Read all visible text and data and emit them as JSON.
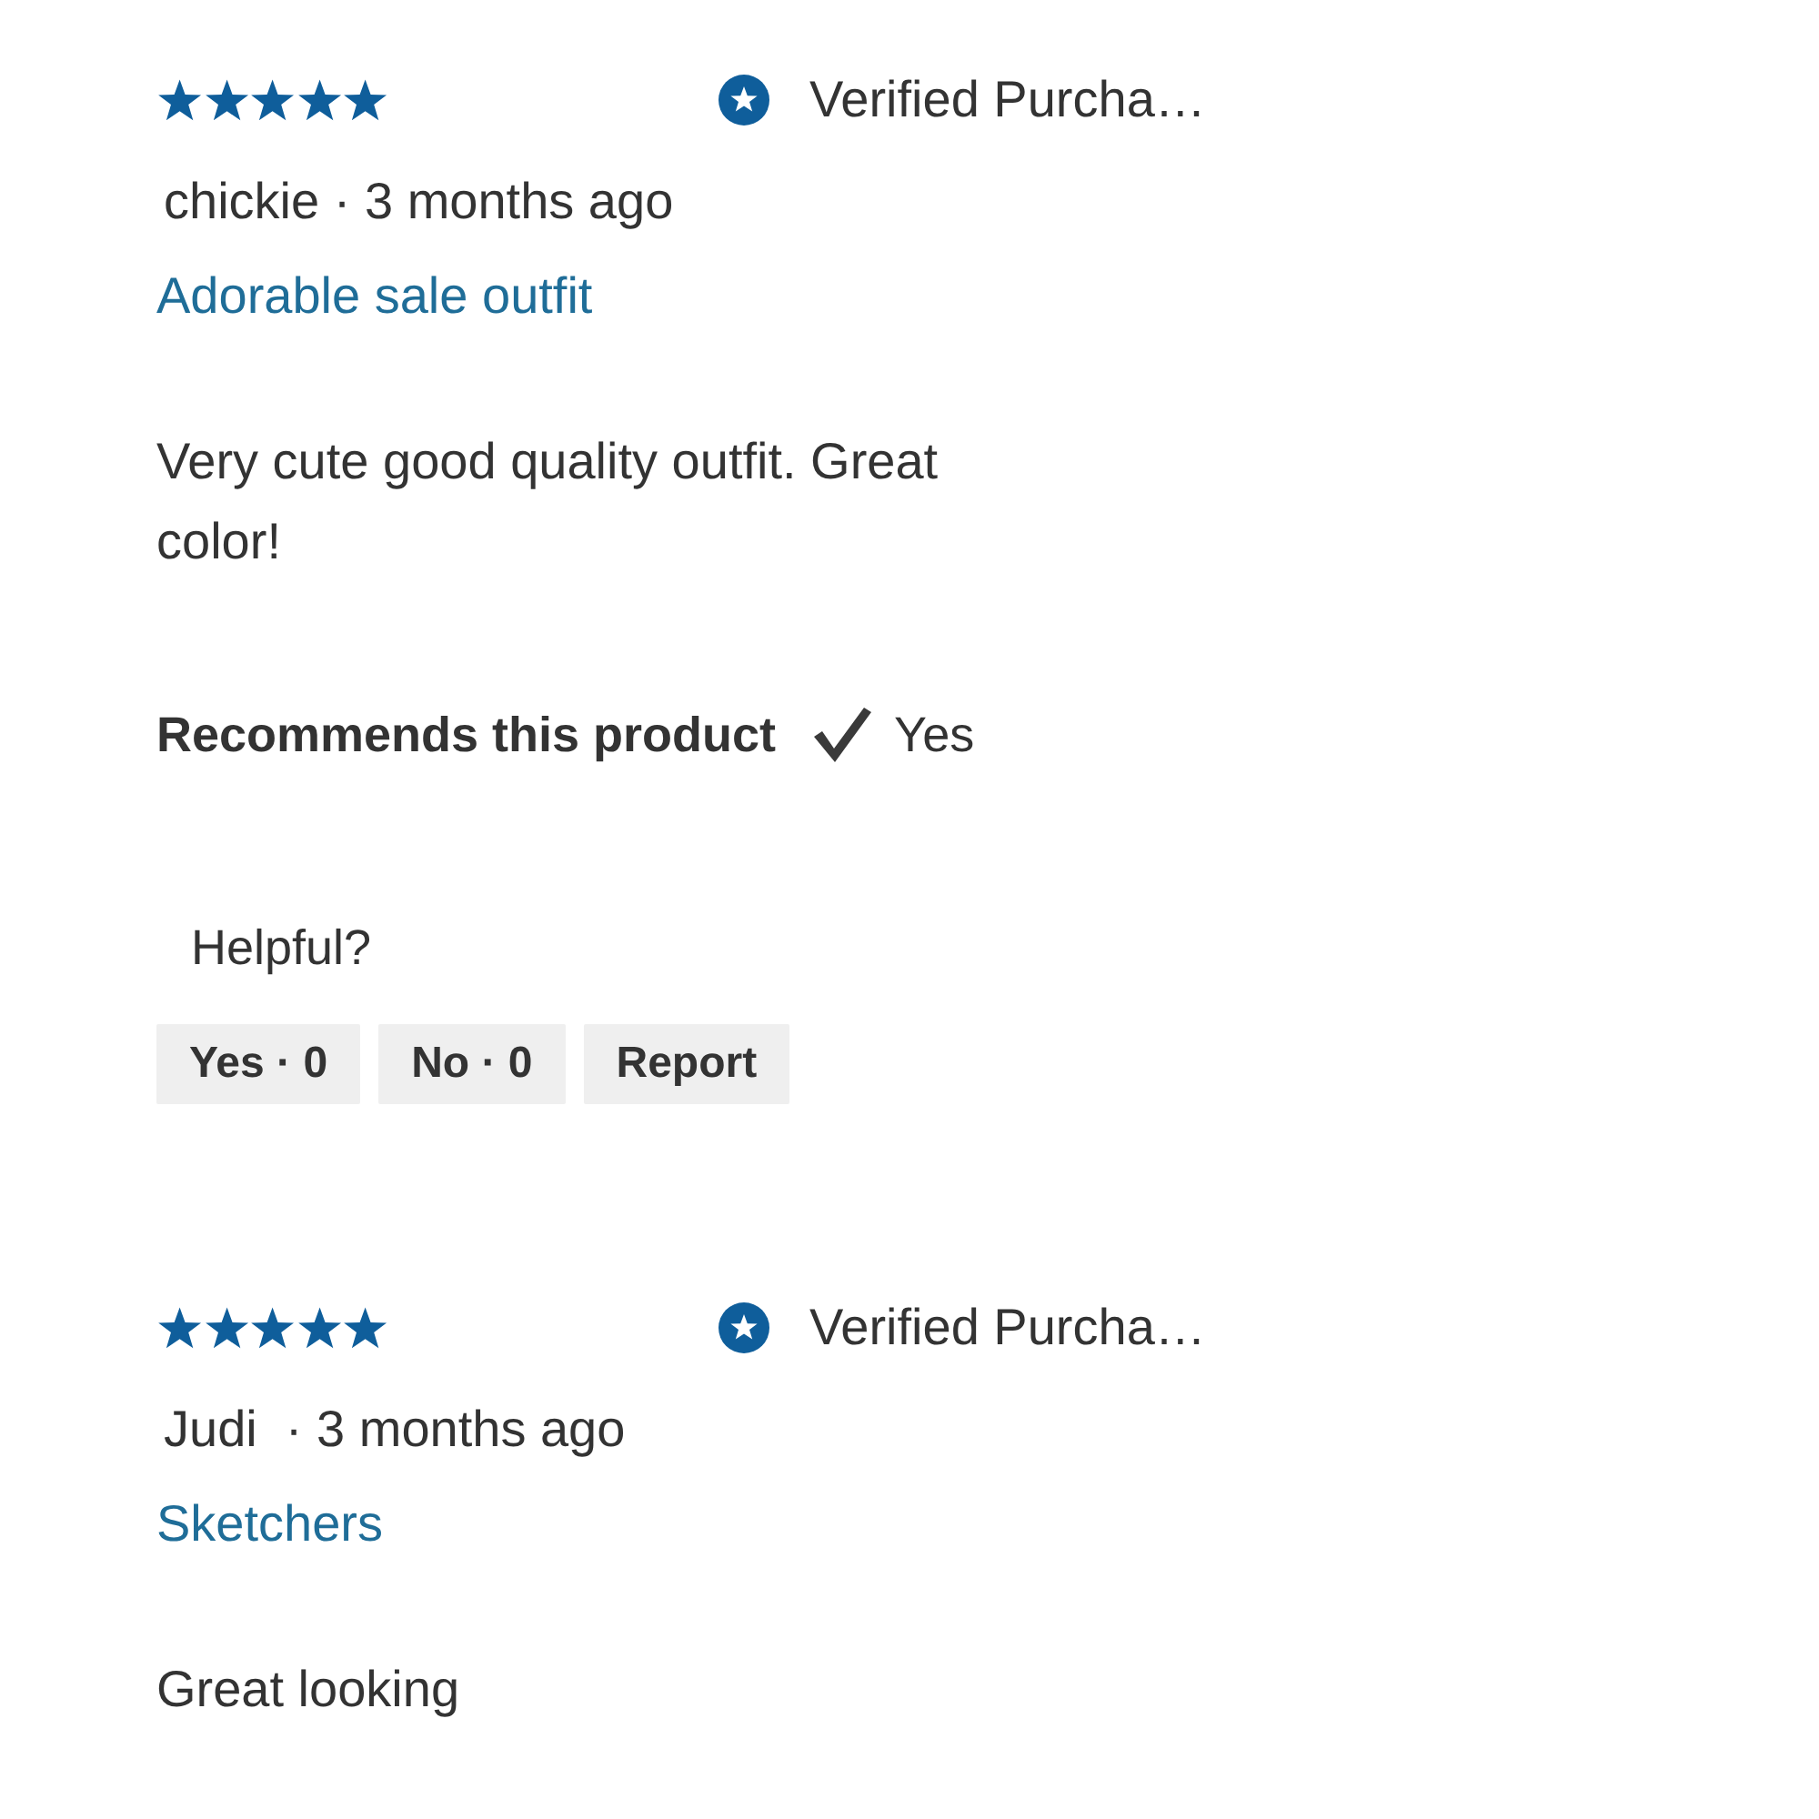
{
  "reviews": [
    {
      "stars": 5,
      "verified_label": "Verified Purcha…",
      "byline": "chickie · 3 months ago",
      "title": "Adorable sale outfit",
      "body": "Very cute good quality outfit. Great color!",
      "recommendation": {
        "label": "Recommends this product",
        "answer": "Yes"
      },
      "helpful": {
        "prompt": "Helpful?",
        "buttons": [
          "Yes · 0",
          "No · 0",
          "Report"
        ]
      }
    },
    {
      "stars": 5,
      "verified_label": "Verified Purcha…",
      "byline": "Judi  · 3 months ago",
      "title": "Sketchers",
      "body": "Great looking"
    }
  ]
}
